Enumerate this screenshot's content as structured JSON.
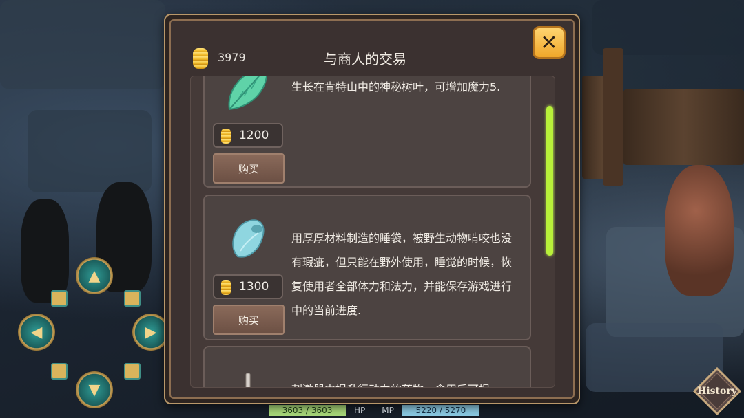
{
  "header": {
    "gold_amount": "3979",
    "title": "与商人的交易",
    "close_icon": "close-x-icon"
  },
  "items": [
    {
      "icon": "leaf-icon",
      "price": "1200",
      "buy_label": "购买",
      "description": "生长在肯特山中的神秘树叶，可增加魔力5."
    },
    {
      "icon": "sleeping-bag-icon",
      "price": "1300",
      "buy_label": "购买",
      "description": "用厚厚材料制造的睡袋，被野生动物啃咬也没有瑕疵，但只能在野外使用，睡觉的时候，恢复使用者全部体力和法力，并能保存游戏进行中的当前进度."
    },
    {
      "icon": "potion-vial-icon",
      "description": "刺激器中提升行动力的药物，食用后可提"
    }
  ],
  "status": {
    "hp_value": "3603 / 3603",
    "hp_label": "HP",
    "mp_label": "MP",
    "mp_value": "5220 / 5270"
  },
  "history_label": "History",
  "colors": {
    "close_button": "#f0a72a",
    "scrollbar": "#b8f03a",
    "hp_bar": "#a9d97a",
    "mp_bar": "#8ccbe4"
  }
}
